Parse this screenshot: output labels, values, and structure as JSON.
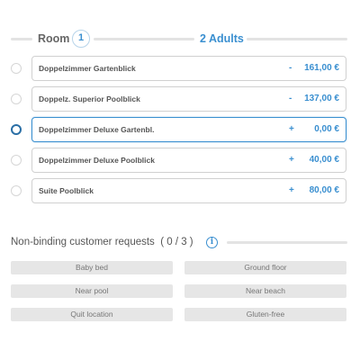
{
  "steps": {
    "room_label": "Room",
    "room_number": "1",
    "adults_label": "2 Adults"
  },
  "rooms": [
    {
      "name": "Doppelzimmer Gartenblick",
      "sign": "-",
      "price": "161,00 €",
      "selected": false
    },
    {
      "name": "Doppelz. Superior Poolblick",
      "sign": "-",
      "price": "137,00 €",
      "selected": false
    },
    {
      "name": "Doppelzimmer Deluxe Gartenbl.",
      "sign": "+",
      "price": "0,00 €",
      "selected": true
    },
    {
      "name": "Doppelzimmer Deluxe Poolblick",
      "sign": "+",
      "price": "40,00 €",
      "selected": false
    },
    {
      "name": "Suite Poolblick",
      "sign": "+",
      "price": "80,00 €",
      "selected": false
    }
  ],
  "requests": {
    "title": "Non-binding customer requests",
    "count": "( 0 / 3 )",
    "info_icon": "info-icon",
    "items": [
      "Baby bed",
      "Ground floor",
      "Near pool",
      "Near beach",
      "Quit location",
      "Gluten-free"
    ]
  },
  "colors": {
    "accent": "#3a8fd0",
    "selected_radio": "#2b6fa6",
    "chip_bg": "#e6e6e6"
  }
}
